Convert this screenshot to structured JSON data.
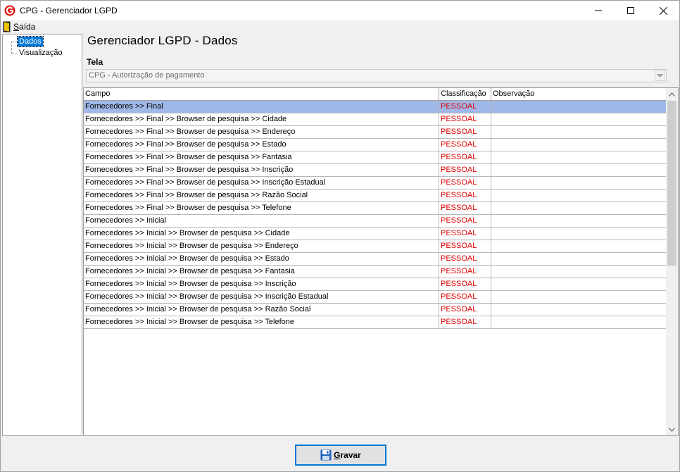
{
  "window": {
    "title": "CPG - Gerenciador LGPD",
    "brand_color": "#e3120b"
  },
  "menu": {
    "exit_label_underlined": "S",
    "exit_label_rest": "aída"
  },
  "tree": {
    "items": [
      {
        "label": "Dados",
        "selected": true
      },
      {
        "label": "Visualização",
        "selected": false
      }
    ]
  },
  "page": {
    "heading": "Gerenciador LGPD - Dados",
    "tela_label": "Tela",
    "tela_value": "CPG - Autorização de pagamento"
  },
  "grid": {
    "columns": [
      "Campo",
      "Classificação",
      "Observação"
    ],
    "rows": [
      {
        "campo": "Fornecedores >> Final",
        "classificacao": "PESSOAL",
        "observacao": ""
      },
      {
        "campo": "Fornecedores >> Final >> Browser de pesquisa >> Cidade",
        "classificacao": "PESSOAL",
        "observacao": ""
      },
      {
        "campo": "Fornecedores >> Final >> Browser de pesquisa >> Endereço",
        "classificacao": "PESSOAL",
        "observacao": ""
      },
      {
        "campo": "Fornecedores >> Final >> Browser de pesquisa >> Estado",
        "classificacao": "PESSOAL",
        "observacao": ""
      },
      {
        "campo": "Fornecedores >> Final >> Browser de pesquisa >> Fantasia",
        "classificacao": "PESSOAL",
        "observacao": ""
      },
      {
        "campo": "Fornecedores >> Final >> Browser de pesquisa >> Inscrição",
        "classificacao": "PESSOAL",
        "observacao": ""
      },
      {
        "campo": "Fornecedores >> Final >> Browser de pesquisa >> Inscrição Estadual",
        "classificacao": "PESSOAL",
        "observacao": ""
      },
      {
        "campo": "Fornecedores >> Final >> Browser de pesquisa >> Razão Social",
        "classificacao": "PESSOAL",
        "observacao": ""
      },
      {
        "campo": "Fornecedores >> Final >> Browser de pesquisa >> Telefone",
        "classificacao": "PESSOAL",
        "observacao": ""
      },
      {
        "campo": "Fornecedores >> Inicial",
        "classificacao": "PESSOAL",
        "observacao": ""
      },
      {
        "campo": "Fornecedores >> Inicial >> Browser de pesquisa >> Cidade",
        "classificacao": "PESSOAL",
        "observacao": ""
      },
      {
        "campo": "Fornecedores >> Inicial >> Browser de pesquisa >> Endereço",
        "classificacao": "PESSOAL",
        "observacao": ""
      },
      {
        "campo": "Fornecedores >> Inicial >> Browser de pesquisa >> Estado",
        "classificacao": "PESSOAL",
        "observacao": ""
      },
      {
        "campo": "Fornecedores >> Inicial >> Browser de pesquisa >> Fantasia",
        "classificacao": "PESSOAL",
        "observacao": ""
      },
      {
        "campo": "Fornecedores >> Inicial >> Browser de pesquisa >> Inscrição",
        "classificacao": "PESSOAL",
        "observacao": ""
      },
      {
        "campo": "Fornecedores >> Inicial >> Browser de pesquisa >> Inscrição Estadual",
        "classificacao": "PESSOAL",
        "observacao": ""
      },
      {
        "campo": "Fornecedores >> Inicial >> Browser de pesquisa >> Razão Social",
        "classificacao": "PESSOAL",
        "observacao": ""
      },
      {
        "campo": "Fornecedores >> Inicial >> Browser de pesquisa >> Telefone",
        "classificacao": "PESSOAL",
        "observacao": ""
      }
    ],
    "selected_row": 0,
    "classification_color": "#e00000",
    "selection_color": "#a0b8e8"
  },
  "footer": {
    "save_label_underlined": "G",
    "save_label_rest": "ravar"
  }
}
